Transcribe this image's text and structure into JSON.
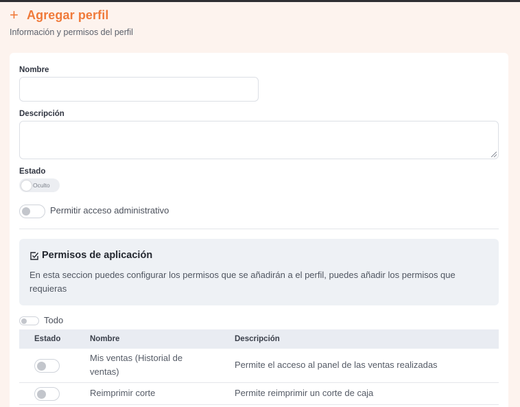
{
  "header": {
    "title": "Agregar perfil",
    "subtitle": "Información y permisos del perfil",
    "icon": "plus-icon",
    "accent_color": "#f07a3a"
  },
  "form": {
    "name_label": "Nombre",
    "name_value": "",
    "description_label": "Descripción",
    "description_value": "",
    "status_label": "Estado",
    "status_value": "Oculto",
    "admin_access_label": "Permitir acceso administrativo",
    "admin_access_enabled": false
  },
  "permissions": {
    "title": "Permisos de aplicación",
    "icon": "checkbox-icon",
    "description": "En esta seccion puedes configurar los permisos que se añadirán a el perfil, puedes añadir los permisos que requieras",
    "select_all_label": "Todo",
    "select_all_enabled": false,
    "columns": [
      "Estado",
      "Nombre",
      "Descripción"
    ],
    "rows": [
      {
        "enabled": false,
        "name": "Mis ventas (Historial de ventas)",
        "description": "Permite el acceso al panel de las ventas realizadas"
      },
      {
        "enabled": false,
        "name": "Reimprimir corte",
        "description": "Permite reimprimir un corte de caja"
      }
    ]
  }
}
